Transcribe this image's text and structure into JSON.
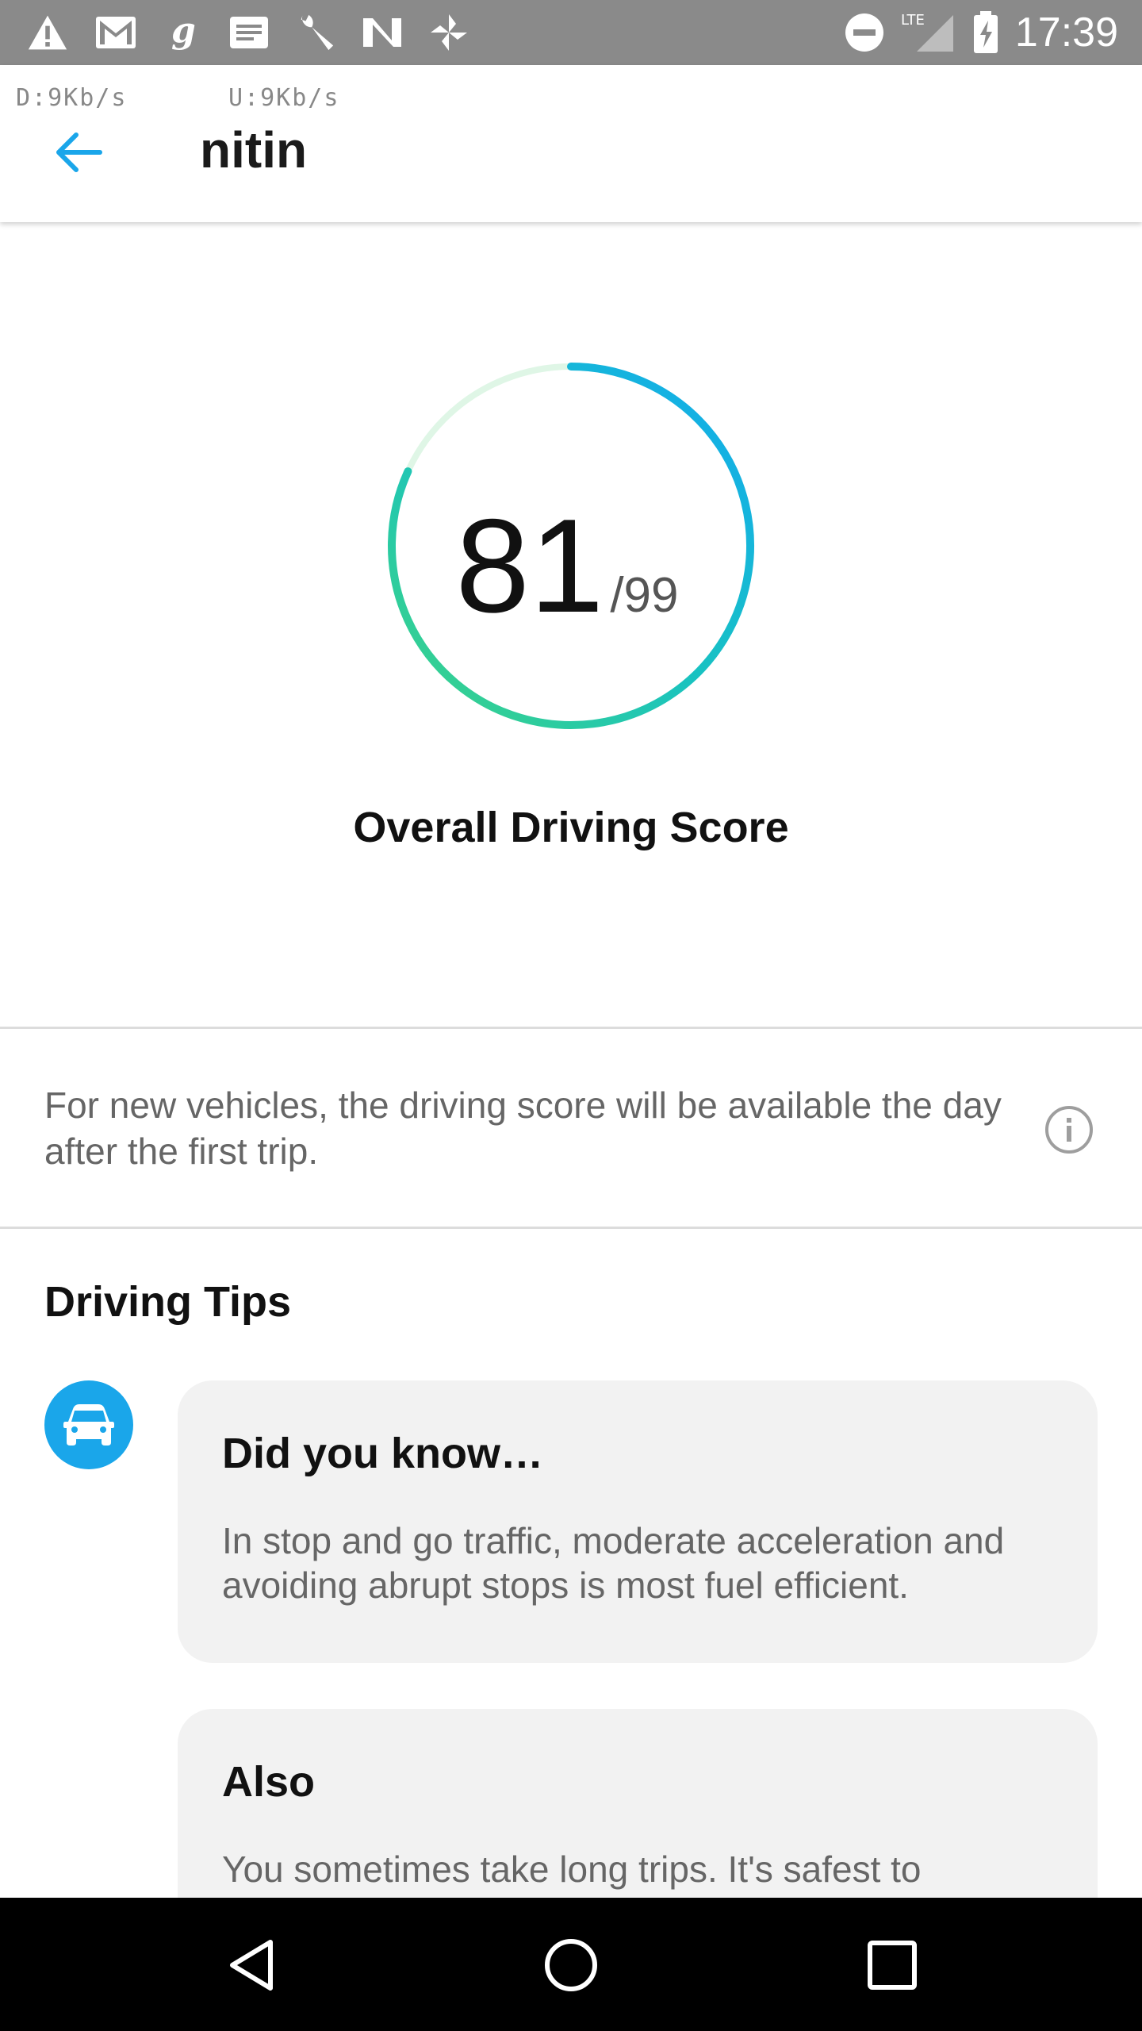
{
  "status_bar": {
    "time": "17:39",
    "network_type": "LTE",
    "icons": [
      "warning-icon",
      "gmail-icon",
      "g-app-icon",
      "message-icon",
      "wrench-icon",
      "n-app-icon",
      "pinwheel-icon",
      "do-not-disturb-icon",
      "signal-icon",
      "battery-icon"
    ]
  },
  "app_bar": {
    "net_down": "D:9Kb/s",
    "net_up": "U:9Kb/s",
    "title": "nitin",
    "back_icon": "arrow-back-icon"
  },
  "score": {
    "value": "81",
    "max_label": "/99",
    "value_num": 81,
    "max_num": 99,
    "label": "Overall Driving Score",
    "colors": {
      "track": "#dff6e6",
      "start": "#3dd484",
      "mid": "#18c2c2",
      "end": "#13aaf0"
    }
  },
  "info": {
    "text": "For new vehicles, the driving score will be available the day after the first trip.",
    "icon": "info-icon"
  },
  "tips": {
    "heading": "Driving Tips",
    "avatar_icon": "car-icon",
    "accent": "#1aa6ea",
    "cards": [
      {
        "title": "Did you know…",
        "body": "In stop and go traffic, moderate acceleration and avoiding abrupt stops is most fuel efficient."
      },
      {
        "title": "Also",
        "body": "You sometimes take long trips. It's safest to"
      }
    ]
  },
  "nav_bar": {
    "back_icon": "nav-back-icon",
    "home_icon": "nav-home-icon",
    "recents_icon": "nav-recents-icon"
  }
}
